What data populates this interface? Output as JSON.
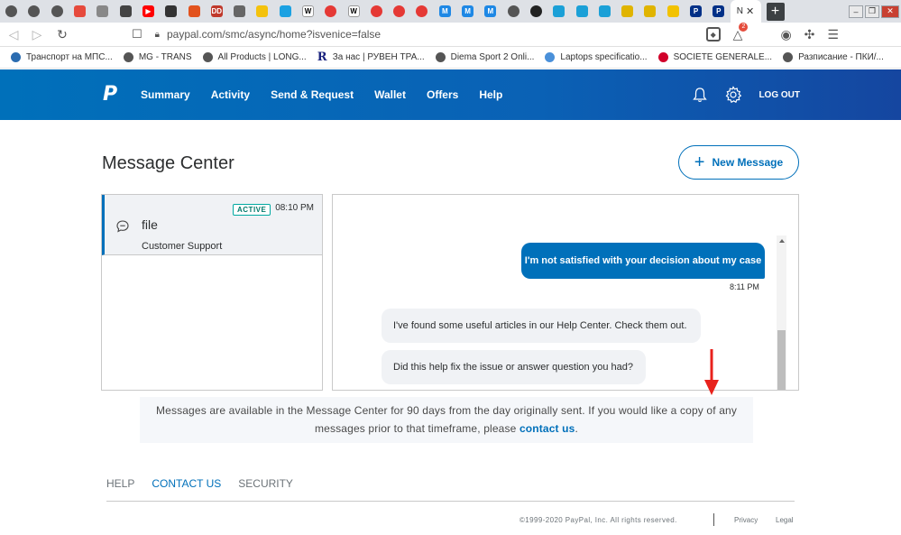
{
  "browser": {
    "tabs": [
      {
        "icon": "globe-icon",
        "color": "#555555",
        "glyph": ""
      },
      {
        "icon": "globe-icon",
        "color": "#555555",
        "glyph": ""
      },
      {
        "icon": "globe-icon",
        "color": "#555555",
        "glyph": ""
      },
      {
        "icon": "mail-icon",
        "color": "#e64a3c",
        "glyph": ""
      },
      {
        "icon": "doc-icon",
        "color": "#888888",
        "glyph": ""
      },
      {
        "icon": "ball-icon",
        "color": "#444444",
        "glyph": ""
      },
      {
        "icon": "youtube-icon",
        "color": "#ff0000",
        "glyph": "▶"
      },
      {
        "icon": "apple-icon",
        "color": "#333333",
        "glyph": ""
      },
      {
        "icon": "office-icon",
        "color": "#e2521d",
        "glyph": ""
      },
      {
        "icon": "dd-icon",
        "color": "#c0392b",
        "glyph": "DD"
      },
      {
        "icon": "spider-icon",
        "color": "#666666",
        "glyph": ""
      },
      {
        "icon": "note-icon",
        "color": "#f4c20d",
        "glyph": ""
      },
      {
        "icon": "chart-icon",
        "color": "#1ba1e2",
        "glyph": ""
      },
      {
        "icon": "wikipedia-icon",
        "color": "#ffffff",
        "glyph": "W"
      },
      {
        "icon": "power-icon",
        "color": "#e53935",
        "glyph": ""
      },
      {
        "icon": "wikipedia-icon",
        "color": "#ffffff",
        "glyph": "W"
      },
      {
        "icon": "power-icon",
        "color": "#e53935",
        "glyph": ""
      },
      {
        "icon": "power-icon",
        "color": "#e53935",
        "glyph": ""
      },
      {
        "icon": "power-icon",
        "color": "#e53935",
        "glyph": ""
      },
      {
        "icon": "doc-icon",
        "color": "#1e88e5",
        "glyph": "M"
      },
      {
        "icon": "doc-icon",
        "color": "#1e88e5",
        "glyph": "M"
      },
      {
        "icon": "doc-icon",
        "color": "#1e88e5",
        "glyph": "M"
      },
      {
        "icon": "globe-icon",
        "color": "#555555",
        "glyph": ""
      },
      {
        "icon": "camera-icon",
        "color": "#222222",
        "glyph": ""
      },
      {
        "icon": "cisco-icon",
        "color": "#1ba0d7",
        "glyph": ""
      },
      {
        "icon": "cisco-icon",
        "color": "#1ba0d7",
        "glyph": ""
      },
      {
        "icon": "cisco-icon",
        "color": "#1ba0d7",
        "glyph": ""
      },
      {
        "icon": "flag-icon",
        "color": "#e0b400",
        "glyph": ""
      },
      {
        "icon": "flag-icon",
        "color": "#e0b400",
        "glyph": ""
      },
      {
        "icon": "hazard-icon",
        "color": "#f2c200",
        "glyph": ""
      },
      {
        "icon": "paypal-icon",
        "color": "#003087",
        "glyph": "P"
      },
      {
        "icon": "paypal-icon",
        "color": "#003087",
        "glyph": "P"
      }
    ],
    "active_tab_letter": "N",
    "url": "paypal.com/smc/async/home?isvenice=false",
    "rewards_badge": "2",
    "bookmarks": [
      {
        "label": "Транспорт на МПС...",
        "icon": "brave-bookmark-icon"
      },
      {
        "label": "MG - TRANS",
        "icon": "globe-icon"
      },
      {
        "label": "All Products | LONG...",
        "icon": "globe-icon"
      },
      {
        "label": "За нас | РУВЕН ТРА...",
        "icon": "r-logo-icon"
      },
      {
        "label": "Diema Sport 2 Onli...",
        "icon": "globe-icon"
      },
      {
        "label": "Laptops specificatio...",
        "icon": "laptop-icon"
      },
      {
        "label": "SOCIETE GENERALE...",
        "icon": "sg-logo-icon"
      },
      {
        "label": "Разписание - ПКИ/...",
        "icon": "globe-icon"
      }
    ]
  },
  "header": {
    "nav": [
      "Summary",
      "Activity",
      "Send & Request",
      "Wallet",
      "Offers",
      "Help"
    ],
    "logout": "LOG OUT",
    "colors": {
      "start": "#0070ba",
      "end": "#1546a0"
    }
  },
  "main": {
    "title": "Message Center",
    "new_message_label": "New Message",
    "conversation": {
      "status": "ACTIVE",
      "time": "08:10 PM",
      "subject": "file",
      "sender": "Customer Support"
    },
    "messages": {
      "outgoing": "I'm not satisfied with your decision about my case",
      "outgoing_time": "8:11 PM",
      "incoming_1": "I've found some useful articles in our Help Center. Check them out.",
      "incoming_2": "Did this help fix the issue or answer question you had?"
    },
    "notice_text": "Messages are available in the Message Center for 90 days from the day originally sent. If you would like a copy of any messages prior to that timeframe, please",
    "notice_link": "contact us",
    "notice_end": "."
  },
  "footer": {
    "help": "HELP",
    "contact": "CONTACT US",
    "security": "SECURITY",
    "copyright": "©1999-2020 PayPal, Inc. All rights reserved.",
    "privacy": "Privacy",
    "legal": "Legal"
  }
}
